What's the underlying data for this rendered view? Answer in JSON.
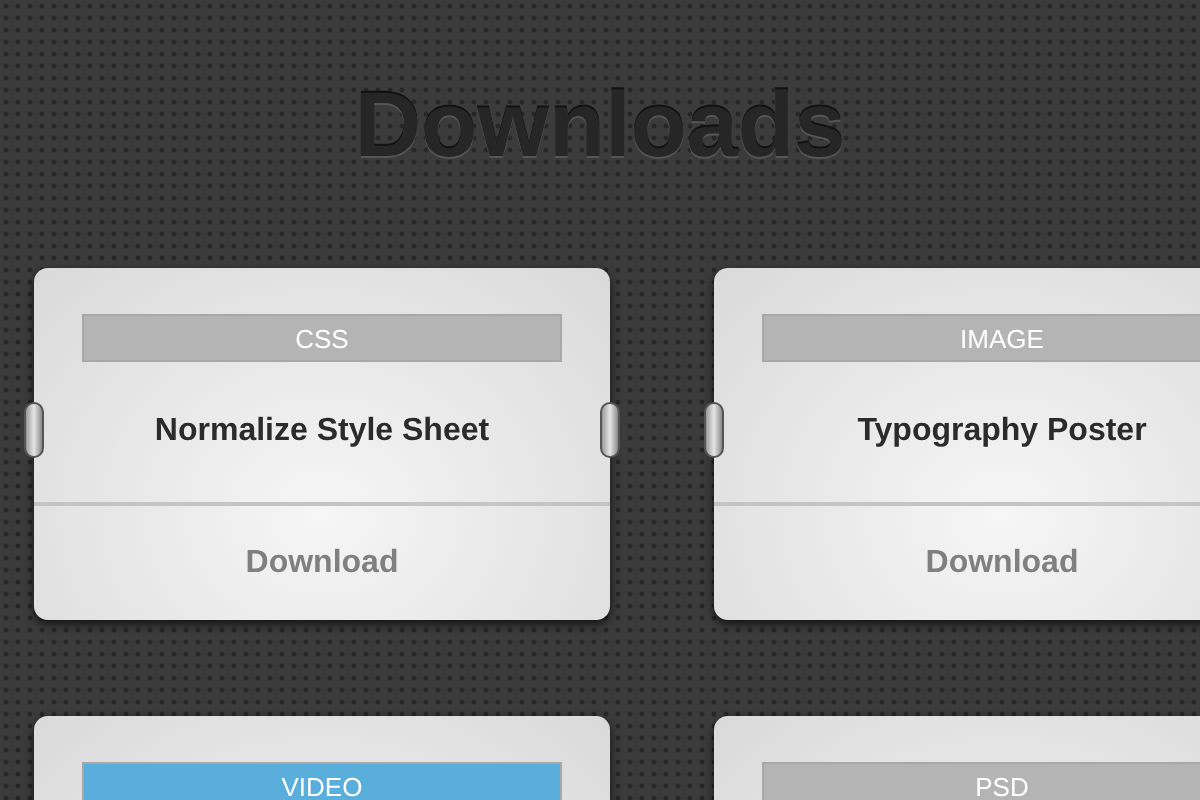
{
  "heading": "Downloads",
  "cards": [
    {
      "tag": "CSS",
      "color": "#b4b4b4",
      "title": "Normalize Style Sheet",
      "action": "Download"
    },
    {
      "tag": "IMAGE",
      "color": "#b4b4b4",
      "title": "Typography Poster",
      "action": "Download"
    },
    {
      "tag": "VIDEO",
      "color": "#5aaedc"
    },
    {
      "tag": "PSD",
      "color": "#b4b4b4"
    }
  ]
}
